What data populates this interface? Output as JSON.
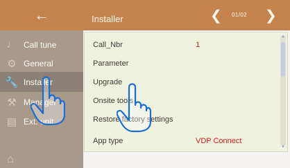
{
  "header": {
    "back_icon": "arrow-left-icon",
    "title": "Installer",
    "prev_icon": "chevron-left-icon",
    "page_indicator": "01/02",
    "next_icon": "chevron-right-icon"
  },
  "sidebar": {
    "items": [
      {
        "label": "Call tune",
        "icon": "music-note-icon"
      },
      {
        "label": "General",
        "icon": "gear-icon"
      },
      {
        "label": "Installer",
        "icon": "wrench-icon"
      },
      {
        "label": "Manager",
        "icon": "tools-icon"
      },
      {
        "label": "Ext. unit",
        "icon": "intercom-icon"
      }
    ],
    "active_index": 2,
    "home_icon": "home-icon"
  },
  "list": {
    "rows": [
      {
        "label": "Call_Nbr",
        "value": "1"
      },
      {
        "label": "Parameter",
        "value": ""
      },
      {
        "label": "Upgrade",
        "value": ""
      },
      {
        "label": "Onsite tools",
        "value": ""
      },
      {
        "label": "Restore factory settings",
        "value": ""
      },
      {
        "label": "App type",
        "value": "VDP Connect"
      }
    ]
  },
  "colors": {
    "accent": "#c5844d",
    "sidebar": "#a8998b",
    "sidebar_active": "#8d8177",
    "value_red": "#d61a1a",
    "panel": "#f0f2e0"
  }
}
